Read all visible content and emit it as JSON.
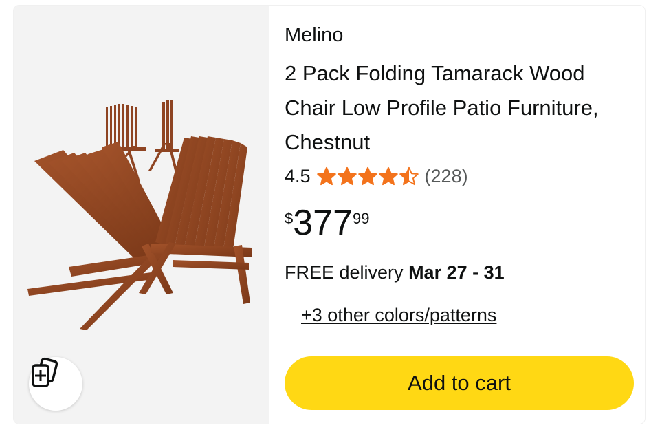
{
  "product": {
    "brand": "Melino",
    "title": "2 Pack Folding Tamarack Wood Chair Low Profile Patio Furniture, Chestnut",
    "image_alt": "chestnut wooden folding chairs",
    "rating": {
      "value_text": "4.5",
      "value": 4.5,
      "max": 5,
      "count_text": "(228)",
      "star_color": "#f3731c"
    },
    "price": {
      "symbol": "$",
      "whole": "377",
      "fraction": "99"
    },
    "delivery": {
      "prefix": "FREE delivery",
      "date": "Mar 27 - 31"
    },
    "variants_link": "+3 other colors/patterns",
    "add_to_cart_label": "Add to cart",
    "add_to_cart_color": "#ffd814"
  },
  "compare_icon": "add-to-compare-icon"
}
